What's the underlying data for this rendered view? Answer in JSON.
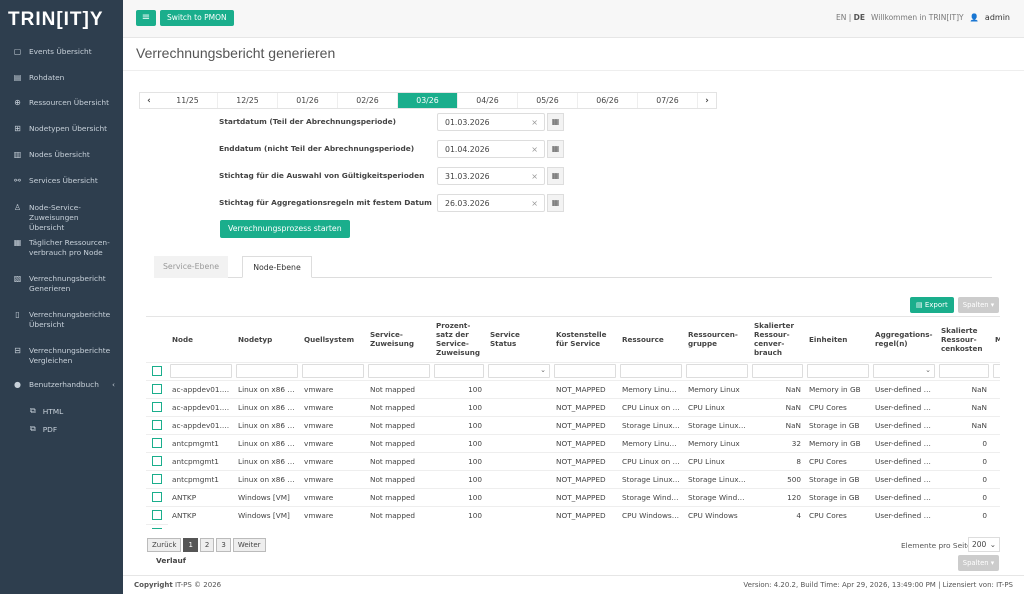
{
  "brand": {
    "logo": "TRIN[IT]Y"
  },
  "sidebar": {
    "items": [
      {
        "label": "Events Übersicht",
        "icon": "calendar-icon"
      },
      {
        "label": "Rohdaten",
        "icon": "list-icon"
      },
      {
        "label": "Ressourcen Übersicht",
        "icon": "globe-icon"
      },
      {
        "label": "Nodetypen Übersicht",
        "icon": "hierarchy-icon"
      },
      {
        "label": "Nodes Übersicht",
        "icon": "server-icon"
      },
      {
        "label": "Services Übersicht",
        "icon": "link-icon"
      },
      {
        "label": "Node-Service-Zuweisungen Übersicht",
        "icon": "sitemap-icon"
      },
      {
        "label": "Täglicher Ressourcen-verbrauch pro Node",
        "icon": "bar-chart-icon"
      },
      {
        "label": "Verrechnungsbericht Generieren",
        "icon": "file-plus-icon"
      },
      {
        "label": "Verrechnungsberichte Übersicht",
        "icon": "file-icon"
      },
      {
        "label": "Verrechnungsberichte Vergleichen",
        "icon": "compare-icon"
      },
      {
        "label": "Benutzerhandbuch",
        "icon": "question-icon"
      }
    ],
    "subitems": [
      {
        "label": "HTML",
        "icon": "external-link-icon"
      },
      {
        "label": "PDF",
        "icon": "external-link-icon"
      }
    ]
  },
  "topbar": {
    "menu_icon": "≡",
    "switch_label": "Switch to PMON",
    "lang_en": "EN",
    "lang_sep": "|",
    "lang_de": "DE",
    "welcome": "Willkommen in TRIN[IT]Y",
    "user": "admin"
  },
  "page": {
    "title": "Verrechnungsbericht generieren"
  },
  "months": {
    "prev": "‹",
    "next": "›",
    "items": [
      "11/25",
      "12/25",
      "01/26",
      "02/26",
      "03/26",
      "04/26",
      "05/26",
      "06/26",
      "07/26"
    ],
    "active_index": 4
  },
  "form": {
    "start_label": "Startdatum (Teil der Abrechnungsperiode)",
    "start_value": "01.03.2026",
    "end_label": "Enddatum (nicht Teil der Abrechnungsperiode)",
    "end_value": "01.04.2026",
    "stichtag_label": "Stichtag für die Auswahl von Gültigkeitsperioden",
    "stichtag_value": "31.03.2026",
    "agg_label": "Stichtag für Aggregationsregeln mit festem Datum",
    "agg_value": "26.03.2026",
    "clear": "×",
    "start_button": "Verrechnungsprozess starten"
  },
  "tabs": {
    "service": "Service-Ebene",
    "node": "Node-Ebene"
  },
  "toolbar": {
    "export": "Export",
    "columns": "Spalten ▾"
  },
  "table": {
    "headers": [
      "Node",
      "Nodetyp",
      "Quellsystem",
      "Service-Zuweisung",
      "Prozent-satz der Service-Zuweisung",
      "Service Status",
      "Kostenstelle für Service",
      "Ressource",
      "Ressourcen-gruppe",
      "Skalierter Ressour-cenver-brauch",
      "Einheiten",
      "Aggregations-regel(n)",
      "Skalierte Ressour-cenkosten",
      "M ko"
    ],
    "rows": [
      [
        "ac-appdev01.acr...",
        "Linux on x86 [VM]",
        "vmware",
        "Not mapped",
        "100",
        "",
        "NOT_MAPPED",
        "Memory Linux o...",
        "Memory Linux",
        "NaN",
        "Memory in GB",
        "User-defined da...",
        "NaN"
      ],
      [
        "ac-appdev01.acr...",
        "Linux on x86 [VM]",
        "vmware",
        "Not mapped",
        "100",
        "",
        "NOT_MAPPED",
        "CPU Linux on x8...",
        "CPU Linux",
        "NaN",
        "CPU Cores",
        "User-defined da...",
        "NaN"
      ],
      [
        "ac-appdev01.acr...",
        "Linux on x86 [VM]",
        "vmware",
        "Not mapped",
        "100",
        "",
        "NOT_MAPPED",
        "Storage Linux o...",
        "Storage Linux M...",
        "NaN",
        "Storage in GB",
        "User-defined da...",
        "NaN"
      ],
      [
        "antcpmgmt1",
        "Linux on x86 [VM]",
        "vmware",
        "Not mapped",
        "100",
        "",
        "NOT_MAPPED",
        "Memory Linux o...",
        "Memory Linux",
        "32",
        "Memory in GB",
        "User-defined da...",
        "0"
      ],
      [
        "antcpmgmt1",
        "Linux on x86 [VM]",
        "vmware",
        "Not mapped",
        "100",
        "",
        "NOT_MAPPED",
        "CPU Linux on x8...",
        "CPU Linux",
        "8",
        "CPU Cores",
        "User-defined da...",
        "0"
      ],
      [
        "antcpmgmt1",
        "Linux on x86 [VM]",
        "vmware",
        "Not mapped",
        "100",
        "",
        "NOT_MAPPED",
        "Storage Linux o...",
        "Storage Linux M...",
        "500",
        "Storage in GB",
        "User-defined da...",
        "0"
      ],
      [
        "ANTKP",
        "Windows [VM]",
        "vmware",
        "Not mapped",
        "100",
        "",
        "NOT_MAPPED",
        "Storage Window...",
        "Storage Window...",
        "120",
        "Storage in GB",
        "User-defined da...",
        "0"
      ],
      [
        "ANTKP",
        "Windows [VM]",
        "vmware",
        "Not mapped",
        "100",
        "",
        "NOT_MAPPED",
        "CPU Windows [V...",
        "CPU Windows",
        "4",
        "CPU Cores",
        "User-defined da...",
        "0"
      ]
    ]
  },
  "pager": {
    "prev": "Zurück",
    "pages": [
      "1",
      "2",
      "3"
    ],
    "next": "Weiter",
    "verlauf": "Verlauf",
    "per_page_label": "Elemente pro Seite:",
    "per_page": "200"
  },
  "footer": {
    "copyright": "Copyright",
    "company": " IT-PS © 2026",
    "version": "Version: 4.20.2, Build Time: Apr 29, 2026, 13:49:00 PM | Lizensiert von: IT-PS"
  }
}
